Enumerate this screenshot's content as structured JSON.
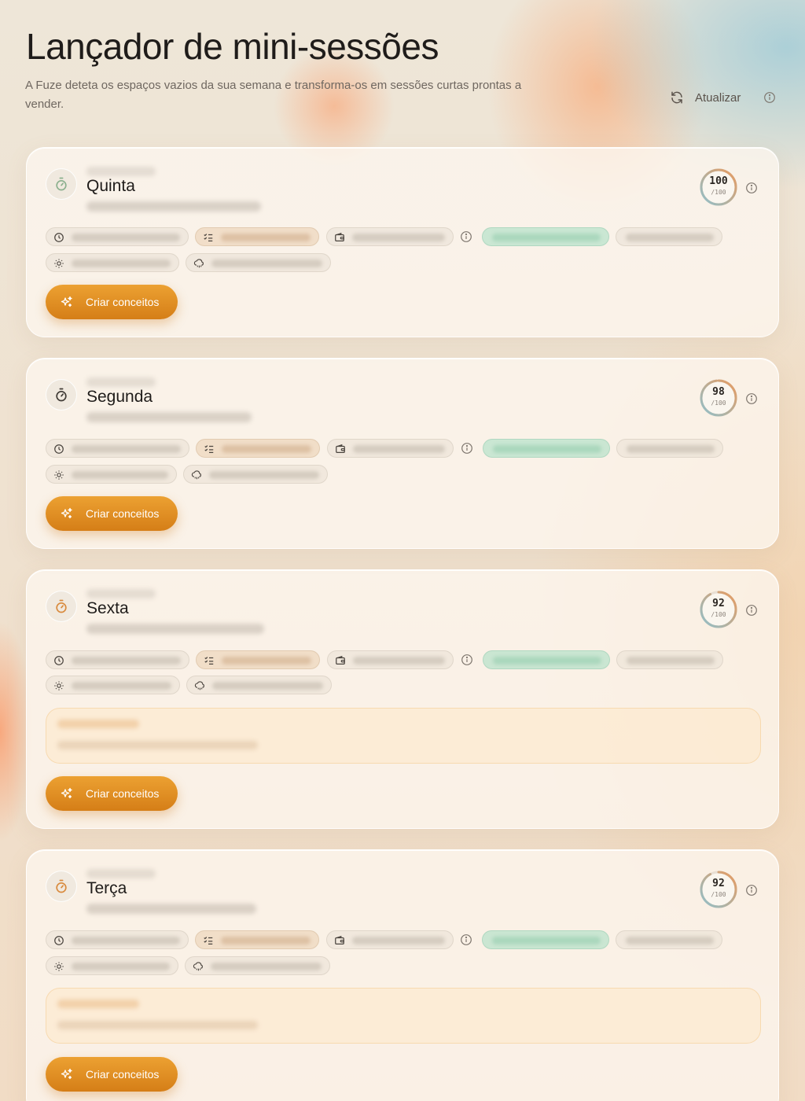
{
  "header": {
    "title": "Lançador de mini-sessões",
    "subtitle": "A Fuze deteta os espaços vazios da sua semana e transforma-os em sessões curtas prontas a vender.",
    "refresh_label": "Atualizar"
  },
  "cta_label": "Criar conceitos",
  "cards": [
    {
      "day": "Quinta",
      "score": "100",
      "score_den": "/100",
      "score_value": 100,
      "accent": "#8bb08e",
      "has_note": false
    },
    {
      "day": "Segunda",
      "score": "98",
      "score_den": "/100",
      "score_value": 98,
      "accent": "#3f3a35",
      "has_note": false
    },
    {
      "day": "Sexta",
      "score": "92",
      "score_den": "/100",
      "score_value": 92,
      "accent": "#d98a3d",
      "has_note": true
    },
    {
      "day": "Terça",
      "score": "92",
      "score_den": "/100",
      "score_value": 92,
      "accent": "#d98a3d",
      "has_note": true
    }
  ],
  "colors": {
    "cta": "#e0891f",
    "score_ring_a": "#8fc0cc",
    "score_ring_b": "#e89a5e",
    "green_chip": "#bfe3cd",
    "tan_chip": "#eed6bb",
    "note_bg": "#fde6c6"
  },
  "icons": {
    "timer": "stopwatch-icon",
    "refresh": "refresh-icon",
    "info": "info-icon",
    "clock": "clock-icon",
    "checklist": "checklist-icon",
    "wallet": "wallet-icon",
    "sun": "sun-icon",
    "cloud": "cloud-rain-icon",
    "sparkles": "sparkles-icon"
  }
}
